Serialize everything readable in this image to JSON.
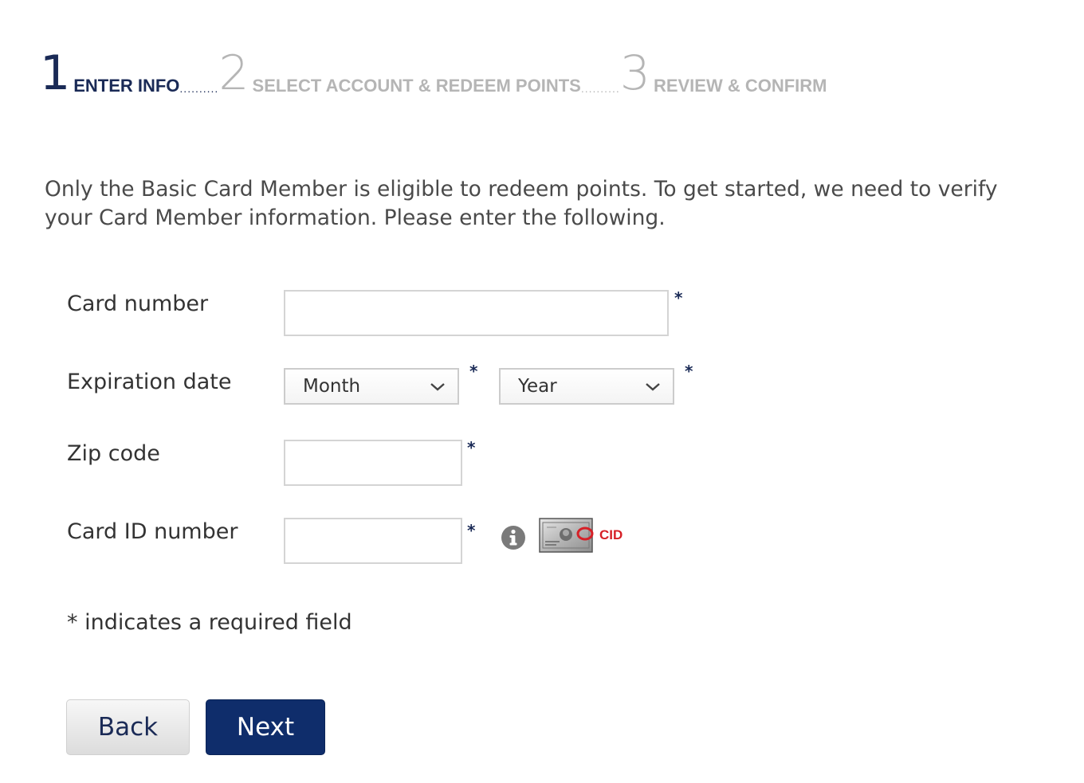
{
  "steps": [
    {
      "number": "1",
      "label": "ENTER INFO",
      "state": "active"
    },
    {
      "number": "2",
      "label": "SELECT ACCOUNT & REDEEM POINTS",
      "state": "inactive"
    },
    {
      "number": "3",
      "label": "REVIEW & CONFIRM",
      "state": "inactive"
    }
  ],
  "intro_text": "Only the Basic Card Member is eligible to redeem points. To get started, we need to verify your Card Member information. Please enter the following.",
  "form": {
    "card_number": {
      "label": "Card number",
      "value": ""
    },
    "expiration": {
      "label": "Expiration date",
      "month_selected": "Month",
      "year_selected": "Year"
    },
    "zip": {
      "label": "Zip code",
      "value": ""
    },
    "card_id": {
      "label": "Card ID number",
      "value": "",
      "cid_label": "CID"
    },
    "required_marker": "*",
    "required_note": "* indicates a required field"
  },
  "buttons": {
    "back": "Back",
    "next": "Next"
  },
  "colors": {
    "brand_navy": "#1a2a56",
    "next_button": "#0f2d6b",
    "inactive_step": "#b5b5b5",
    "cid_red": "#d62027"
  }
}
